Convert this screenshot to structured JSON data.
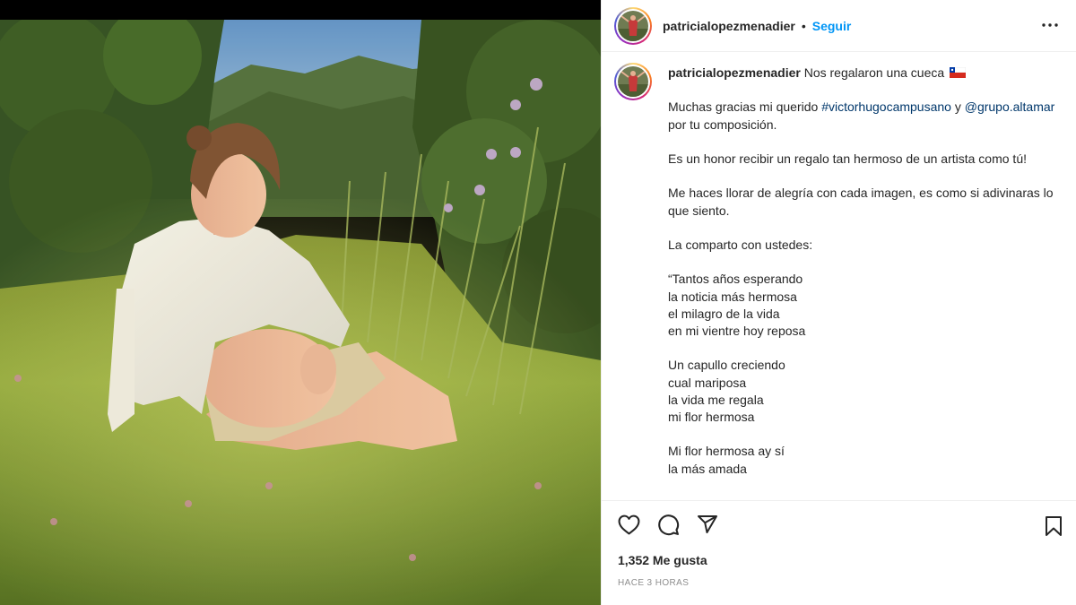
{
  "post": {
    "username": "patricialopezmenadier",
    "separator": "•",
    "follow_label": "Seguir",
    "more_icon": "more-horizontal-icon"
  },
  "caption": {
    "username": "patricialopezmenadier",
    "first_line": "Nos regalaron una cueca",
    "flag_icon": "chile-flag-icon",
    "para1_pre": "Muchas gracias mi querido",
    "para1_hashtag": "#victorhugocampusano",
    "para1_mid": "y",
    "para1_mention": "@grupo.altamar",
    "para1_post": "por tu composición.",
    "para2": "Es un honor recibir un regalo tan hermoso de un artista como tú!",
    "para3": "Me haces llorar de alegría con cada imagen, es como si adivinaras lo que siento.",
    "para4": "La comparto con ustedes:",
    "verse1": [
      "“Tantos años esperando",
      "la noticia más hermosa",
      "el milagro de la vida",
      "en mi vientre hoy reposa"
    ],
    "verse2": [
      "Un capullo creciendo",
      "cual mariposa",
      "la vida me regala",
      "mi flor hermosa"
    ],
    "verse3": [
      "Mi flor hermosa ay sí",
      "la más amada"
    ]
  },
  "actions": {
    "like_icon": "heart-icon",
    "comment_icon": "comment-icon",
    "share_icon": "paper-plane-icon",
    "save_icon": "bookmark-icon"
  },
  "likes_text": "1,352 Me gusta",
  "time_text": "HACE 3 HORAS",
  "colors": {
    "link": "#00376b",
    "follow": "#0095f6",
    "muted": "#8e8e8e",
    "divider": "#efefef"
  }
}
